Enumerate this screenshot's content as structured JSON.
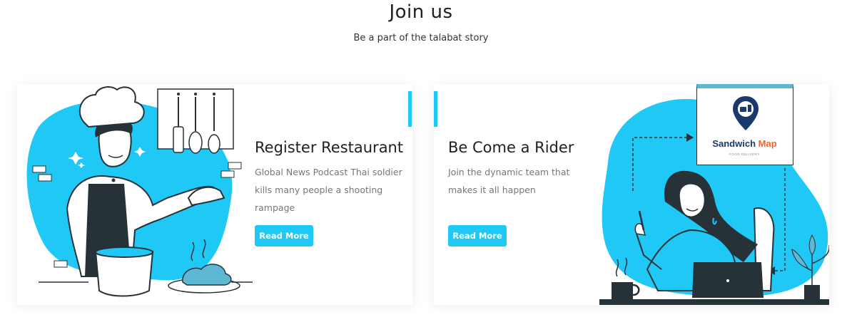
{
  "section": {
    "title": "Join us",
    "subtitle": "Be a part of the talabat story"
  },
  "cards": [
    {
      "title": "Register Restaurant",
      "description": "Global News Podcast Thai soldier kills many people a shooting rampage",
      "button_label": "Read More",
      "illustration": "chef-cooking-illustration"
    },
    {
      "title": "Be Come a Rider",
      "description": "Join the dynamic team that makes it all happen",
      "button_label": "Read More",
      "illustration": "woman-with-laptop-illustration",
      "logo": {
        "name_part1": "Sandwich",
        "name_part2": "Map",
        "tagline": "FOOD DELIVERY"
      }
    }
  ],
  "colors": {
    "accent": "#1fc8f5",
    "logo_navy": "#1b3a6b",
    "logo_orange": "#f26522",
    "dark_outline": "#263238"
  }
}
